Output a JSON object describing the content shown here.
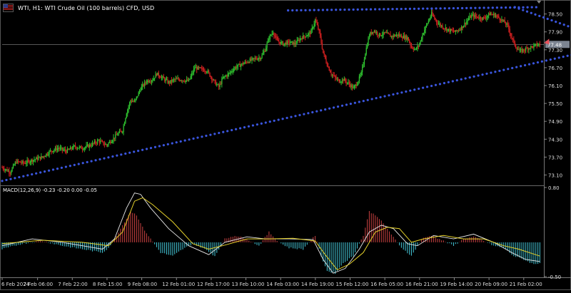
{
  "header": {
    "title": "WTI, H1:  WTI Crude Oil (100 barrels) CFD, USD",
    "flag_icon": "us-flag-icon"
  },
  "colors": {
    "background": "#000000",
    "bull": "#2fc22f",
    "bear": "#d12020",
    "trendline": "#3a55dd",
    "macd_pos": "#b83c3c",
    "macd_neg": "#3fb8c8",
    "signal": "#e6d22c",
    "macd_line": "#e8e8e8",
    "price_marker": "#e8505a"
  },
  "chart_data": {
    "type": "candlestick",
    "price_axis": {
      "ticks": [
        "78.50",
        "77.90",
        "77.30",
        "76.70",
        "76.10",
        "75.50",
        "74.90",
        "74.30",
        "73.70",
        "73.10"
      ],
      "ylim": [
        72.8,
        78.85
      ]
    },
    "current_price": "77.48",
    "time_axis": {
      "ticks": [
        "6 Feb 2024",
        "7 Feb 06:00",
        "7 Feb 22:00",
        "8 Feb 15:00",
        "9 Feb 08:00",
        "12 Feb 01:00",
        "12 Feb 17:00",
        "13 Feb 10:00",
        "14 Feb 03:00",
        "14 Feb 19:00",
        "15 Feb 12:00",
        "16 Feb 05:00",
        "16 Feb 21:00",
        "19 Feb 14:00",
        "20 Feb 09:00",
        "21 Feb 02:00"
      ]
    },
    "close_path": [
      [
        0,
        73.35
      ],
      [
        8,
        73.2
      ],
      [
        14,
        73.55
      ],
      [
        22,
        73.5
      ],
      [
        30,
        73.6
      ],
      [
        40,
        73.7
      ],
      [
        48,
        73.9
      ],
      [
        56,
        74.0
      ],
      [
        64,
        73.9
      ],
      [
        72,
        74.05
      ],
      [
        80,
        74.0
      ],
      [
        88,
        74.1
      ],
      [
        96,
        74.25
      ],
      [
        104,
        74.1
      ],
      [
        110,
        74.3
      ],
      [
        116,
        74.5
      ],
      [
        120,
        74.6
      ],
      [
        124,
        75.2
      ],
      [
        128,
        75.6
      ],
      [
        132,
        75.55
      ],
      [
        138,
        76.0
      ],
      [
        144,
        76.25
      ],
      [
        150,
        76.3
      ],
      [
        154,
        76.5
      ],
      [
        160,
        76.35
      ],
      [
        166,
        76.2
      ],
      [
        172,
        76.3
      ],
      [
        178,
        76.3
      ],
      [
        186,
        76.25
      ],
      [
        192,
        76.7
      ],
      [
        198,
        76.65
      ],
      [
        204,
        76.6
      ],
      [
        208,
        76.4
      ],
      [
        212,
        76.2
      ],
      [
        216,
        76.05
      ],
      [
        220,
        76.35
      ],
      [
        226,
        76.5
      ],
      [
        232,
        76.7
      ],
      [
        238,
        76.8
      ],
      [
        244,
        76.9
      ],
      [
        252,
        77.0
      ],
      [
        258,
        77.05
      ],
      [
        262,
        77.3
      ],
      [
        266,
        77.7
      ],
      [
        270,
        77.9
      ],
      [
        274,
        77.6
      ],
      [
        280,
        77.5
      ],
      [
        286,
        77.55
      ],
      [
        292,
        77.5
      ],
      [
        298,
        77.7
      ],
      [
        304,
        77.8
      ],
      [
        308,
        77.9
      ],
      [
        312,
        78.3
      ],
      [
        316,
        77.9
      ],
      [
        320,
        77.2
      ],
      [
        324,
        76.8
      ],
      [
        328,
        76.5
      ],
      [
        332,
        76.35
      ],
      [
        336,
        76.25
      ],
      [
        340,
        76.3
      ],
      [
        346,
        76.15
      ],
      [
        350,
        76.0
      ],
      [
        354,
        76.2
      ],
      [
        358,
        76.5
      ],
      [
        362,
        77.2
      ],
      [
        366,
        77.8
      ],
      [
        370,
        77.95
      ],
      [
        376,
        77.8
      ],
      [
        382,
        77.85
      ],
      [
        388,
        77.75
      ],
      [
        394,
        77.8
      ],
      [
        398,
        77.75
      ],
      [
        404,
        77.7
      ],
      [
        408,
        77.4
      ],
      [
        412,
        77.3
      ],
      [
        416,
        77.5
      ],
      [
        420,
        77.9
      ],
      [
        424,
        78.2
      ],
      [
        428,
        78.5
      ],
      [
        434,
        78.2
      ],
      [
        440,
        78.05
      ],
      [
        446,
        77.95
      ],
      [
        452,
        77.9
      ],
      [
        458,
        78.05
      ],
      [
        464,
        78.3
      ],
      [
        468,
        78.45
      ],
      [
        474,
        78.4
      ],
      [
        480,
        78.35
      ],
      [
        486,
        78.5
      ],
      [
        492,
        78.45
      ],
      [
        498,
        78.3
      ],
      [
        504,
        78.1
      ],
      [
        508,
        77.7
      ],
      [
        512,
        77.4
      ],
      [
        516,
        77.25
      ],
      [
        520,
        77.3
      ],
      [
        524,
        77.35
      ],
      [
        528,
        77.4
      ],
      [
        532,
        77.45
      ],
      [
        536,
        77.48
      ]
    ],
    "trendlines": [
      {
        "name": "upper",
        "from": [
          285,
          78.62
        ],
        "to": [
          535,
          78.73
        ]
      },
      {
        "name": "upper-slope",
        "from": [
          511,
          78.73
        ],
        "to": [
          615,
          77.48
        ]
      },
      {
        "name": "lower",
        "from": [
          0,
          72.9
        ],
        "to": [
          615,
          77.48
        ]
      }
    ],
    "macd": {
      "label": "MACD(12,26,9) -0.23 -0.20 0.00 -0.05",
      "axis_ticks": [
        "0.80",
        "-0.50"
      ],
      "ylim": [
        -0.5,
        0.8
      ],
      "histogram_path": [
        [
          0,
          -0.1
        ],
        [
          20,
          -0.02
        ],
        [
          40,
          0.02
        ],
        [
          60,
          -0.05
        ],
        [
          80,
          -0.1
        ],
        [
          100,
          -0.15
        ],
        [
          106,
          -0.08
        ],
        [
          112,
          0.05
        ],
        [
          120,
          0.25
        ],
        [
          128,
          0.45
        ],
        [
          134,
          0.4
        ],
        [
          140,
          0.22
        ],
        [
          148,
          0.05
        ],
        [
          158,
          -0.15
        ],
        [
          170,
          -0.2
        ],
        [
          180,
          -0.1
        ],
        [
          190,
          -0.02
        ],
        [
          200,
          -0.08
        ],
        [
          212,
          -0.2
        ],
        [
          222,
          0.05
        ],
        [
          232,
          0.1
        ],
        [
          244,
          0.05
        ],
        [
          256,
          -0.05
        ],
        [
          266,
          0.15
        ],
        [
          276,
          0.0
        ],
        [
          286,
          -0.08
        ],
        [
          300,
          -0.1
        ],
        [
          312,
          0.1
        ],
        [
          318,
          -0.2
        ],
        [
          324,
          -0.42
        ],
        [
          332,
          -0.45
        ],
        [
          340,
          -0.3
        ],
        [
          350,
          -0.2
        ],
        [
          360,
          0.1
        ],
        [
          366,
          0.45
        ],
        [
          374,
          0.38
        ],
        [
          384,
          0.2
        ],
        [
          396,
          -0.05
        ],
        [
          408,
          -0.2
        ],
        [
          418,
          0.05
        ],
        [
          428,
          0.1
        ],
        [
          440,
          0.02
        ],
        [
          450,
          -0.05
        ],
        [
          460,
          0.05
        ],
        [
          470,
          0.08
        ],
        [
          480,
          0.02
        ],
        [
          490,
          -0.05
        ],
        [
          500,
          -0.08
        ],
        [
          510,
          -0.2
        ],
        [
          520,
          -0.25
        ],
        [
          530,
          -0.32
        ],
        [
          536,
          -0.3
        ]
      ],
      "signal_path": [
        [
          0,
          -0.02
        ],
        [
          40,
          0.03
        ],
        [
          80,
          0.0
        ],
        [
          106,
          -0.05
        ],
        [
          120,
          0.15
        ],
        [
          132,
          0.6
        ],
        [
          140,
          0.65
        ],
        [
          150,
          0.55
        ],
        [
          170,
          0.3
        ],
        [
          190,
          -0.02
        ],
        [
          206,
          -0.1
        ],
        [
          222,
          -0.04
        ],
        [
          244,
          0.05
        ],
        [
          266,
          0.05
        ],
        [
          290,
          0.06
        ],
        [
          312,
          0.02
        ],
        [
          322,
          -0.18
        ],
        [
          334,
          -0.4
        ],
        [
          346,
          -0.32
        ],
        [
          360,
          -0.15
        ],
        [
          372,
          0.15
        ],
        [
          384,
          0.22
        ],
        [
          396,
          0.2
        ],
        [
          408,
          0.0
        ],
        [
          420,
          0.05
        ],
        [
          440,
          0.1
        ],
        [
          460,
          0.05
        ],
        [
          480,
          0.05
        ],
        [
          500,
          -0.05
        ],
        [
          515,
          -0.1
        ],
        [
          536,
          -0.2
        ]
      ],
      "macd_path": [
        [
          0,
          -0.05
        ],
        [
          30,
          0.05
        ],
        [
          60,
          0.0
        ],
        [
          100,
          -0.1
        ],
        [
          112,
          0.05
        ],
        [
          124,
          0.5
        ],
        [
          132,
          0.72
        ],
        [
          138,
          0.7
        ],
        [
          148,
          0.5
        ],
        [
          166,
          0.2
        ],
        [
          186,
          -0.05
        ],
        [
          206,
          -0.18
        ],
        [
          222,
          0.0
        ],
        [
          244,
          0.08
        ],
        [
          262,
          0.05
        ],
        [
          286,
          0.05
        ],
        [
          310,
          0.04
        ],
        [
          320,
          -0.25
        ],
        [
          330,
          -0.45
        ],
        [
          342,
          -0.38
        ],
        [
          356,
          -0.1
        ],
        [
          366,
          0.15
        ],
        [
          378,
          0.25
        ],
        [
          390,
          0.2
        ],
        [
          404,
          -0.02
        ],
        [
          414,
          -0.05
        ],
        [
          430,
          0.1
        ],
        [
          450,
          0.05
        ],
        [
          470,
          0.12
        ],
        [
          490,
          0.0
        ],
        [
          508,
          -0.15
        ],
        [
          522,
          -0.25
        ],
        [
          536,
          -0.28
        ]
      ]
    }
  }
}
